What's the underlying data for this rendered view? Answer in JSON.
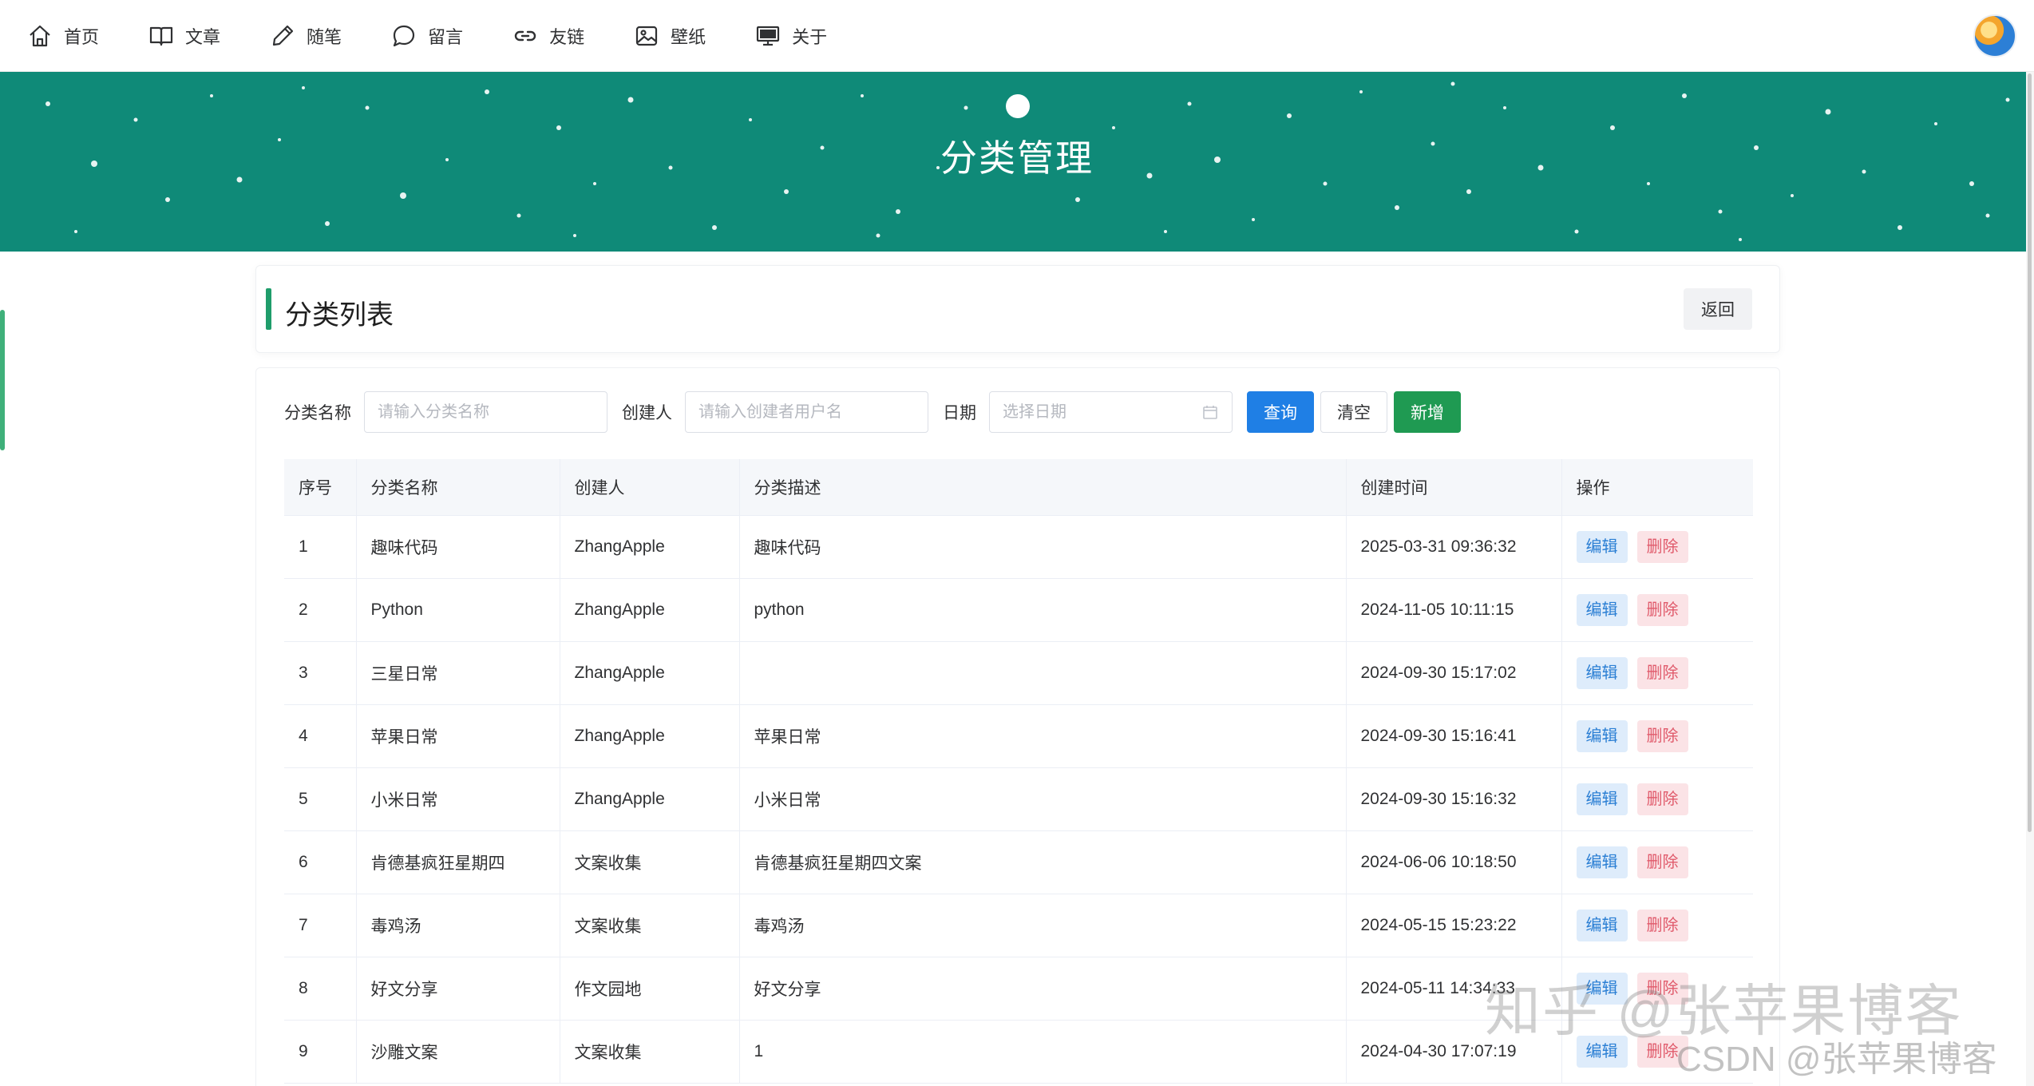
{
  "nav": {
    "items": [
      {
        "label": "首页",
        "icon": "home-icon"
      },
      {
        "label": "文章",
        "icon": "book-icon"
      },
      {
        "label": "随笔",
        "icon": "pen-icon"
      },
      {
        "label": "留言",
        "icon": "chat-icon"
      },
      {
        "label": "友链",
        "icon": "link-icon"
      },
      {
        "label": "壁纸",
        "icon": "image-icon"
      },
      {
        "label": "关于",
        "icon": "monitor-icon"
      }
    ]
  },
  "banner": {
    "title": "分类管理",
    "bg_color": "#0f8a78"
  },
  "section": {
    "title": "分类列表",
    "back_label": "返回"
  },
  "filters": {
    "name_label": "分类名称",
    "name_placeholder": "请输入分类名称",
    "creator_label": "创建人",
    "creator_placeholder": "请输入创建者用户名",
    "date_label": "日期",
    "date_placeholder": "选择日期",
    "query_label": "查询",
    "clear_label": "清空",
    "add_label": "新增"
  },
  "table": {
    "headers": {
      "index": "序号",
      "name": "分类名称",
      "creator": "创建人",
      "desc": "分类描述",
      "created": "创建时间",
      "ops": "操作"
    },
    "edit_label": "编辑",
    "delete_label": "删除",
    "rows": [
      {
        "index": "1",
        "name": "趣味代码",
        "creator": "ZhangApple",
        "desc": "趣味代码",
        "created": "2025-03-31 09:36:32"
      },
      {
        "index": "2",
        "name": "Python",
        "creator": "ZhangApple",
        "desc": "python",
        "created": "2024-11-05 10:11:15"
      },
      {
        "index": "3",
        "name": "三星日常",
        "creator": "ZhangApple",
        "desc": "",
        "created": "2024-09-30 15:17:02"
      },
      {
        "index": "4",
        "name": "苹果日常",
        "creator": "ZhangApple",
        "desc": "苹果日常",
        "created": "2024-09-30 15:16:41"
      },
      {
        "index": "5",
        "name": "小米日常",
        "creator": "ZhangApple",
        "desc": "小米日常",
        "created": "2024-09-30 15:16:32"
      },
      {
        "index": "6",
        "name": "肯德基疯狂星期四",
        "creator": "文案收集",
        "desc": "肯德基疯狂星期四文案",
        "created": "2024-06-06 10:18:50"
      },
      {
        "index": "7",
        "name": "毒鸡汤",
        "creator": "文案收集",
        "desc": "毒鸡汤",
        "created": "2024-05-15 15:23:22"
      },
      {
        "index": "8",
        "name": "好文分享",
        "creator": "作文园地",
        "desc": "好文分享",
        "created": "2024-05-11 14:34:33"
      },
      {
        "index": "9",
        "name": "沙雕文案",
        "creator": "文案收集",
        "desc": "1",
        "created": "2024-04-30 17:07:19"
      }
    ]
  },
  "watermark": {
    "line1": "知乎 @张苹果博客",
    "line2": "CSDN @张苹果博客"
  }
}
